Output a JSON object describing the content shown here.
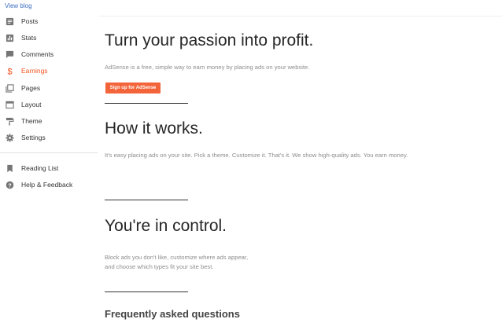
{
  "sidebar": {
    "view_blog": "View blog",
    "items": [
      {
        "label": "Posts",
        "icon": "posts-icon"
      },
      {
        "label": "Stats",
        "icon": "stats-icon"
      },
      {
        "label": "Comments",
        "icon": "comments-icon"
      },
      {
        "label": "Earnings",
        "icon": "dollar-icon",
        "active": true
      },
      {
        "label": "Pages",
        "icon": "pages-icon"
      },
      {
        "label": "Layout",
        "icon": "layout-icon"
      },
      {
        "label": "Theme",
        "icon": "paint-roller-icon"
      },
      {
        "label": "Settings",
        "icon": "gear-icon"
      }
    ],
    "secondary_items": [
      {
        "label": "Reading List",
        "icon": "bookmark-icon"
      },
      {
        "label": "Help & Feedback",
        "icon": "help-icon"
      }
    ]
  },
  "main": {
    "hero": {
      "title": "Turn your passion into profit.",
      "description": "AdSense is a free, simple way to earn money by placing ads on your website.",
      "button_label": "Sign up for AdSense"
    },
    "how_it_works": {
      "title": "How it works.",
      "description": "It's easy placing ads on your site. Pick a theme. Customize it. That's it. We show high-quality ads. You earn money."
    },
    "control": {
      "title": "You're in control.",
      "description_lines": [
        "Block ads you don't like, customize where ads appear,",
        "and choose which types fit your site best."
      ]
    },
    "faq_title": "Frequently asked questions"
  },
  "colors": {
    "accent": "#f4511e",
    "button": "#f4643a",
    "link": "#3d6ec1",
    "icon": "#757575"
  }
}
